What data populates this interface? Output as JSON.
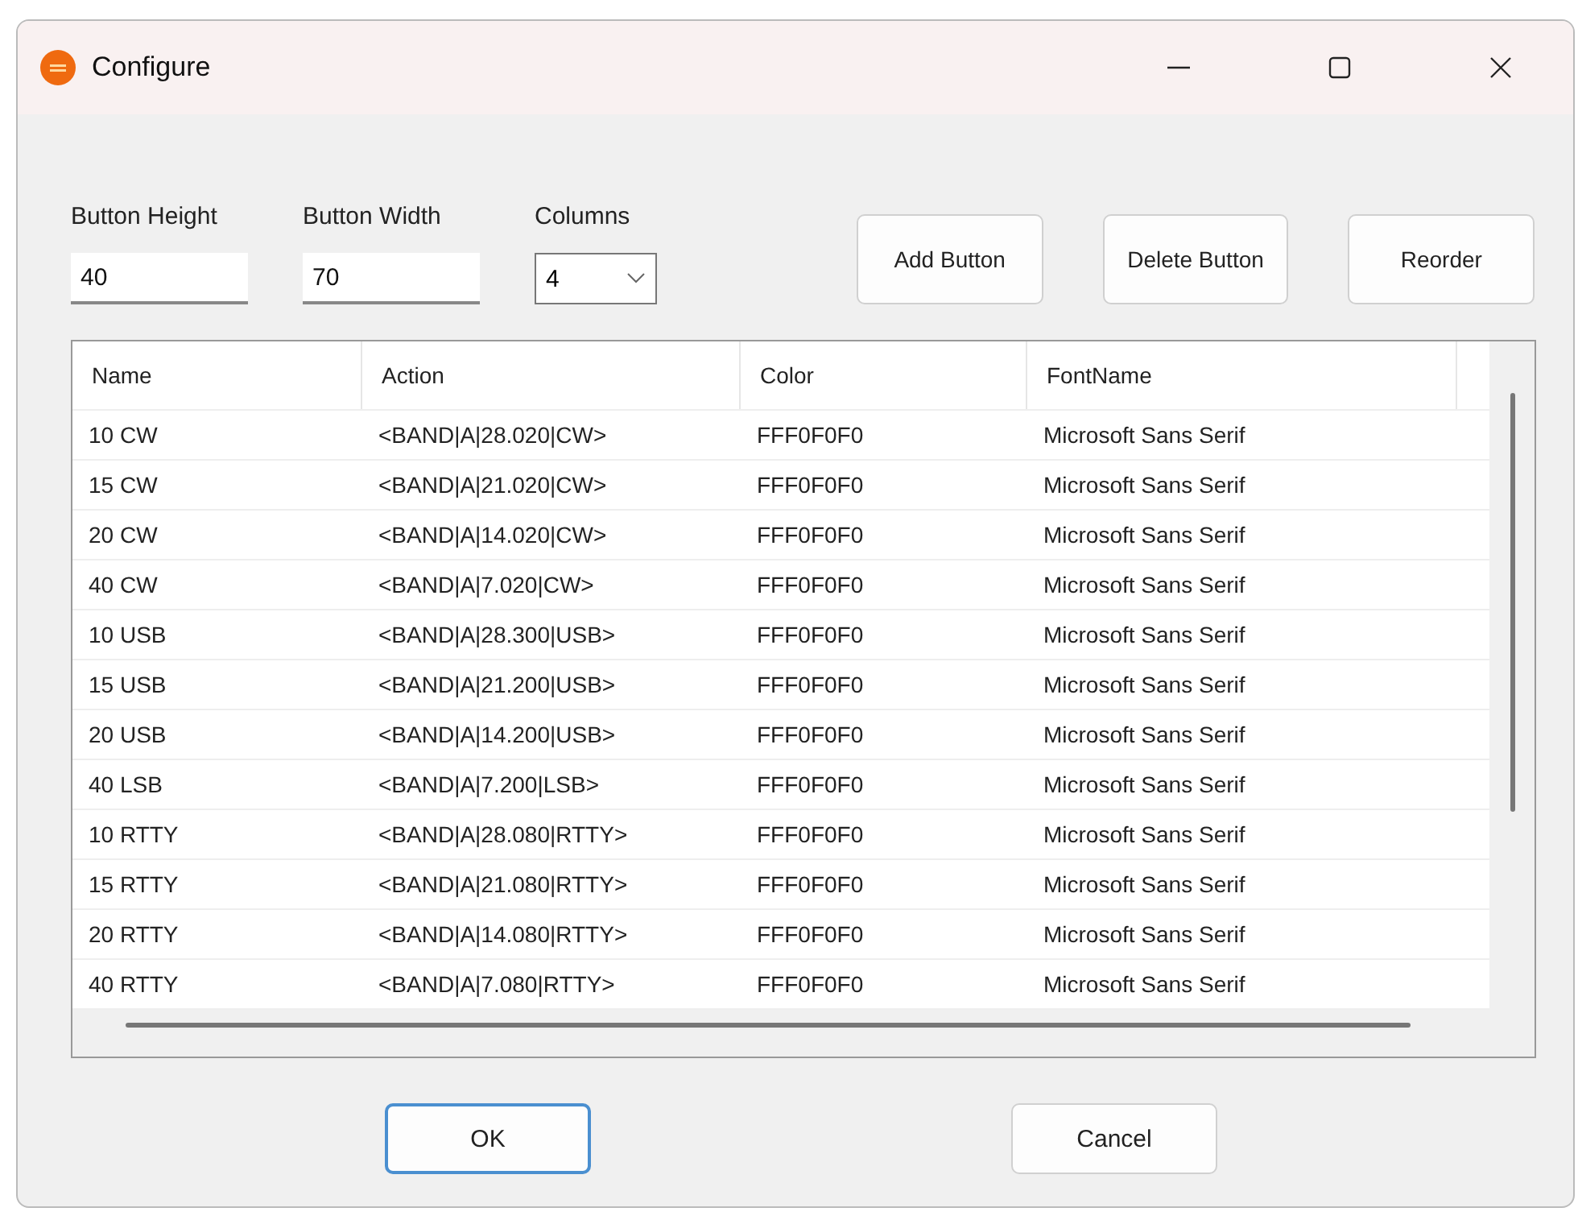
{
  "window": {
    "title": "Configure"
  },
  "fields": [
    {
      "label": "Button Height",
      "value": "40",
      "kind": "text"
    },
    {
      "label": "Button Width",
      "value": "70",
      "kind": "text"
    },
    {
      "label": "Columns",
      "value": "4",
      "kind": "combo"
    }
  ],
  "actions": [
    {
      "label": "Add Button"
    },
    {
      "label": "Delete Button"
    },
    {
      "label": "Reorder"
    }
  ],
  "table": {
    "columns": [
      "Name",
      "Action",
      "Color",
      "FontName"
    ],
    "rows": [
      [
        "10 CW",
        "<BAND|A|28.020|CW>",
        "FFF0F0F0",
        "Microsoft Sans Serif"
      ],
      [
        "15 CW",
        "<BAND|A|21.020|CW>",
        "FFF0F0F0",
        "Microsoft Sans Serif"
      ],
      [
        "20 CW",
        "<BAND|A|14.020|CW>",
        "FFF0F0F0",
        "Microsoft Sans Serif"
      ],
      [
        "40 CW",
        "<BAND|A|7.020|CW>",
        "FFF0F0F0",
        "Microsoft Sans Serif"
      ],
      [
        "10 USB",
        "<BAND|A|28.300|USB>",
        "FFF0F0F0",
        "Microsoft Sans Serif"
      ],
      [
        "15 USB",
        "<BAND|A|21.200|USB>",
        "FFF0F0F0",
        "Microsoft Sans Serif"
      ],
      [
        "20 USB",
        "<BAND|A|14.200|USB>",
        "FFF0F0F0",
        "Microsoft Sans Serif"
      ],
      [
        "40 LSB",
        "<BAND|A|7.200|LSB>",
        "FFF0F0F0",
        "Microsoft Sans Serif"
      ],
      [
        "10 RTTY",
        "<BAND|A|28.080|RTTY>",
        "FFF0F0F0",
        "Microsoft Sans Serif"
      ],
      [
        "15 RTTY",
        "<BAND|A|21.080|RTTY>",
        "FFF0F0F0",
        "Microsoft Sans Serif"
      ],
      [
        "20 RTTY",
        "<BAND|A|14.080|RTTY>",
        "FFF0F0F0",
        "Microsoft Sans Serif"
      ],
      [
        "40 RTTY",
        "<BAND|A|7.080|RTTY>",
        "FFF0F0F0",
        "Microsoft Sans Serif"
      ]
    ]
  },
  "footer": [
    {
      "label": "OK",
      "default": true
    },
    {
      "label": "Cancel",
      "default": false
    }
  ]
}
